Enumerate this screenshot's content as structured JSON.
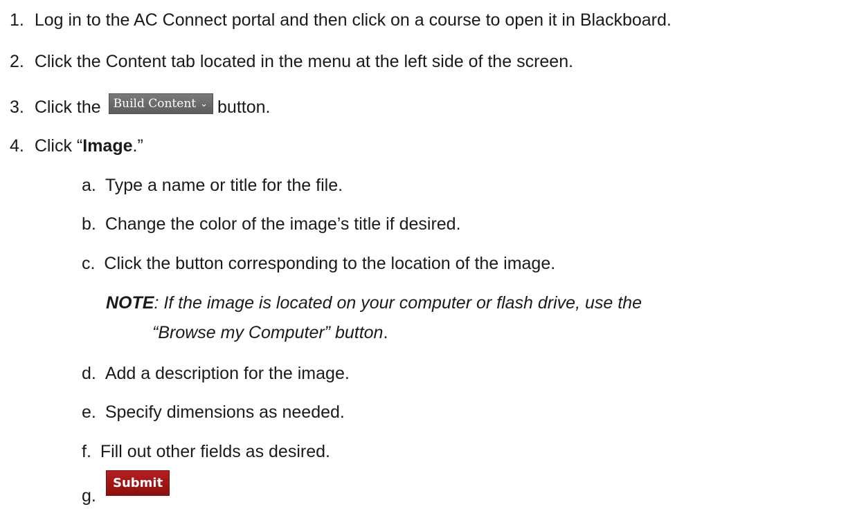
{
  "steps": [
    {
      "num": "1.",
      "text": "Log in to the AC Connect portal and then click on a course to open it in Blackboard."
    },
    {
      "num": "2.",
      "text": "Click the Content tab located in the menu at the left side of the screen."
    },
    {
      "num": "3.",
      "text_before": "Click the",
      "text_after": "button.",
      "button_label": "Build Content",
      "button_icon": "chevron-down-icon"
    },
    {
      "num": "4.",
      "text_prefix": "Click “",
      "text_bold": "Image",
      "text_suffix": ".”"
    }
  ],
  "substeps": [
    {
      "letter": "a.",
      "text": "Type a name or title for the file."
    },
    {
      "letter": "b.",
      "text": "Change the color of the image’s title if desired."
    },
    {
      "letter": "c.",
      "text": "Click the button corresponding to the location of the image."
    },
    {
      "letter": "d.",
      "text": "Add a description for the image."
    },
    {
      "letter": "e.",
      "text": "Specify dimensions as needed."
    },
    {
      "letter": "f.",
      "text": "Fill out other fields as desired."
    },
    {
      "letter": "g.",
      "button_label": "Submit"
    }
  ],
  "note": {
    "label": "NOTE",
    "line1": ":  If the image is located on your computer or flash drive, use the",
    "line2_italic": "“Browse my Computer” button",
    "line2_end": "."
  },
  "colors": {
    "build_content_button": "#6a6a6a",
    "submit_button": "#a51818"
  }
}
